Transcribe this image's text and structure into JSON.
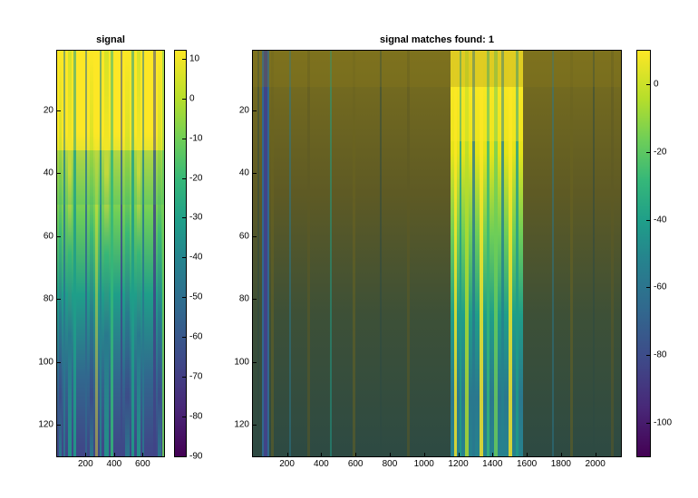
{
  "chart_data": [
    {
      "type": "heatmap",
      "title": "signal",
      "xlim": [
        1,
        750
      ],
      "ylim": [
        1,
        130
      ],
      "xticks": [
        200,
        400,
        600
      ],
      "yticks": [
        20,
        40,
        60,
        80,
        100,
        120
      ],
      "colorbar": {
        "range": [
          -90,
          12
        ],
        "ticks": [
          10,
          0,
          -10,
          -20,
          -30,
          -40,
          -50,
          -60,
          -70,
          -80,
          -90
        ]
      },
      "colormap": "parula",
      "description": "Spectrogram-like signal; predominantly yellow/cyan with blue vertical streaks, turbulent columns."
    },
    {
      "type": "heatmap",
      "title": "signal matches found: 1",
      "xlim": [
        1,
        2150
      ],
      "ylim": [
        1,
        130
      ],
      "xticks": [
        200,
        400,
        600,
        800,
        1000,
        1200,
        1400,
        1600,
        1800,
        2000
      ],
      "yticks": [
        20,
        40,
        60,
        80,
        100,
        120
      ],
      "colorbar": {
        "range": [
          -110,
          10
        ],
        "ticks": [
          0,
          -20,
          -40,
          -60,
          -80,
          -100
        ]
      },
      "colormap": "parula",
      "description": "Wider spectrogram; dark olive background, narrow blue column near x≈70, bright yellow/cyan band x≈1150–1570."
    }
  ]
}
